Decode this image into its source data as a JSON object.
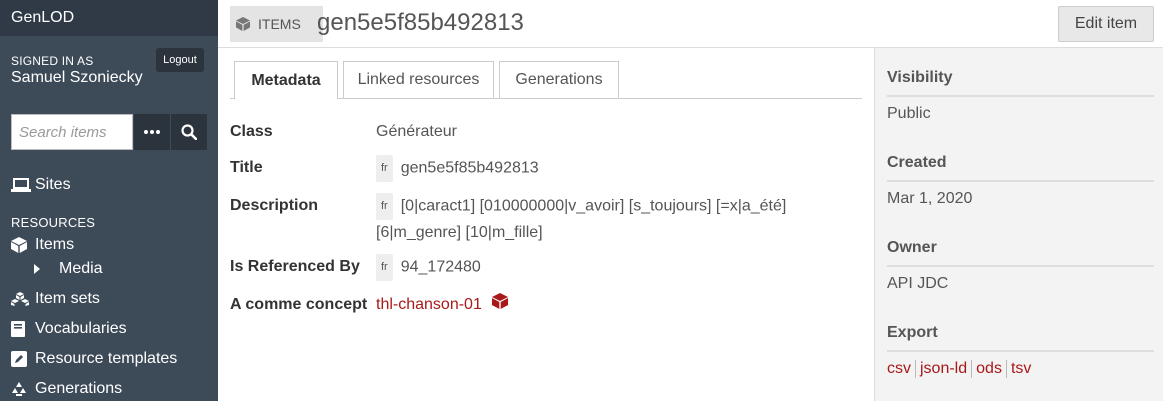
{
  "sidebar": {
    "brand": "GenLOD",
    "signed_in_as": "SIGNED IN AS",
    "user_name": "Samuel Szoniecky",
    "logout_label": "Logout",
    "search_placeholder": "Search items",
    "sites_label": "Sites",
    "resources_header": "RESOURCES",
    "items_label": "Items",
    "media_label": "Media",
    "item_sets_label": "Item sets",
    "vocabularies_label": "Vocabularies",
    "resource_templates_label": "Resource templates",
    "generations_label": "Generations"
  },
  "header": {
    "breadcrumb": "ITEMS",
    "title": "gen5e5f85b492813",
    "edit_label": "Edit item"
  },
  "tabs": [
    "Metadata",
    "Linked resources",
    "Generations"
  ],
  "properties": {
    "class_label": "Class",
    "class_value": "Générateur",
    "title_label": "Title",
    "title_lang": "fr",
    "title_value": "gen5e5f85b492813",
    "description_label": "Description",
    "description_lang": "fr",
    "description_line1": "[0|caract1] [010000000|v_avoir] [s_toujours] [=x|a_été]",
    "description_line2": "[6|m_genre] [10|m_fille]",
    "referenced_label": "Is Referenced By",
    "referenced_lang": "fr",
    "referenced_value": "94_172480",
    "concept_label": "A comme concept",
    "concept_value": "thl-chanson-01"
  },
  "panel": {
    "visibility_label": "Visibility",
    "visibility_value": "Public",
    "created_label": "Created",
    "created_value": "Mar 1, 2020",
    "owner_label": "Owner",
    "owner_value": "API JDC",
    "export_label": "Export",
    "export_formats": [
      "csv",
      "json-ld",
      "ods",
      "tsv"
    ]
  },
  "colors": {
    "sidebar_bg": "#3d4a58",
    "link": "#a91919"
  }
}
